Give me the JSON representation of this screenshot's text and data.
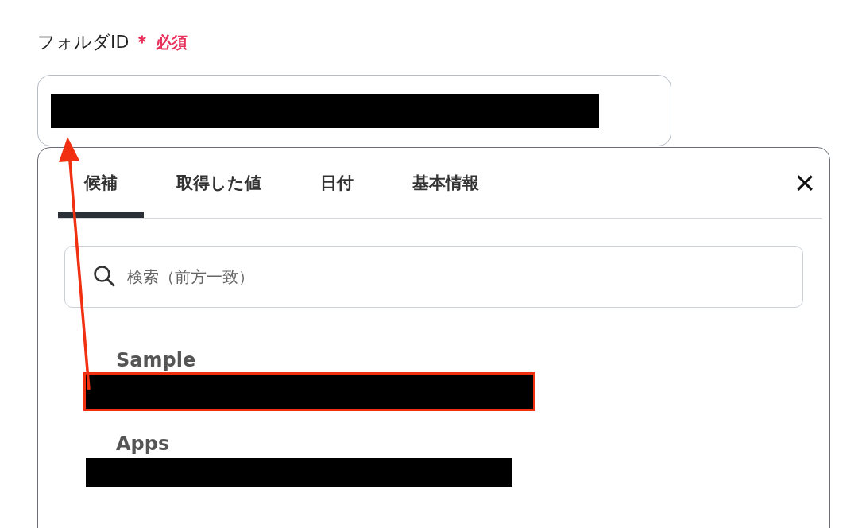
{
  "field": {
    "label": "フォルダID",
    "required_mark": "＊",
    "required_text": "必須",
    "value_redacted": true
  },
  "picker": {
    "tabs": [
      {
        "label": "候補",
        "selected": true
      },
      {
        "label": "取得した値",
        "selected": false
      },
      {
        "label": "日付",
        "selected": false
      },
      {
        "label": "基本情報",
        "selected": false
      }
    ],
    "close": "×",
    "search": {
      "placeholder": "検索（前方一致）"
    },
    "items": [
      {
        "title": "Sample",
        "highlighted": true
      },
      {
        "title": "Apps",
        "highlighted": false
      }
    ]
  },
  "annotation_arrow": true
}
